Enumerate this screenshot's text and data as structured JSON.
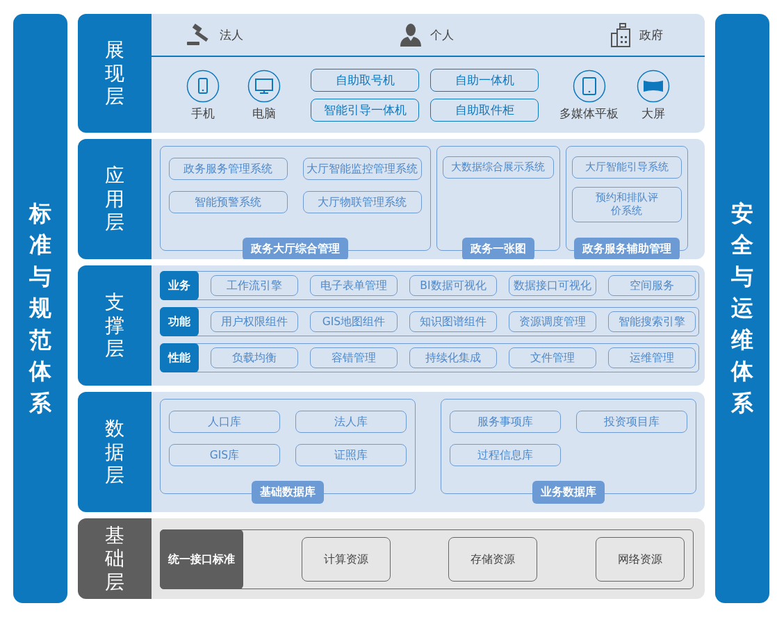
{
  "left_pillar": {
    "title": "标准与规范体系"
  },
  "right_pillar": {
    "title": "安全与运维体系"
  },
  "layers": [
    {
      "kind": "presentation",
      "title": "展现层",
      "users": [
        {
          "label": "法人"
        },
        {
          "label": "个人"
        },
        {
          "label": "政府"
        }
      ],
      "devices_left": [
        {
          "label": "手机"
        },
        {
          "label": "电脑"
        }
      ],
      "terminals": [
        "自助取号机",
        "自助一体机",
        "智能引导一体机",
        "自助取件柜"
      ],
      "devices_right": [
        {
          "label": "多媒体平板"
        },
        {
          "label": "大屏"
        }
      ]
    },
    {
      "kind": "application",
      "title": "应用层",
      "groups": [
        {
          "title": "政务大厅综合管理",
          "items": [
            "政务服务管理系统",
            "大厅智能监控管理系统",
            "智能预警系统",
            "大厅物联管理系统"
          ]
        },
        {
          "title": "政务一张图",
          "items": [
            "大数据综合展示系统"
          ]
        },
        {
          "title": "政务服务辅助管理",
          "items": [
            "大厅智能引导系统",
            "预约和排队评价系统"
          ]
        }
      ]
    },
    {
      "kind": "support",
      "title": "支撑层",
      "rows": [
        {
          "label": "业务",
          "items": [
            "工作流引擎",
            "电子表单管理",
            "BI数据可视化",
            "数据接口可视化",
            "空间服务"
          ]
        },
        {
          "label": "功能",
          "items": [
            "用户权限组件",
            "GIS地图组件",
            "知识图谱组件",
            "资源调度管理",
            "智能搜索引擎"
          ]
        },
        {
          "label": "性能",
          "items": [
            "负载均衡",
            "容错管理",
            "持续化集成",
            "文件管理",
            "运维管理"
          ]
        }
      ]
    },
    {
      "kind": "data",
      "title": "数据层",
      "groups": [
        {
          "title": "基础数据库",
          "items": [
            "人口库",
            "法人库",
            "GIS库",
            "证照库"
          ]
        },
        {
          "title": "业务数据库",
          "items": [
            "服务事项库",
            "投资项目库",
            "过程信息库"
          ]
        }
      ]
    },
    {
      "kind": "base",
      "title": "基础层",
      "interface": "统一接口标准",
      "items": [
        "计算资源",
        "存储资源",
        "网络资源"
      ]
    }
  ]
}
